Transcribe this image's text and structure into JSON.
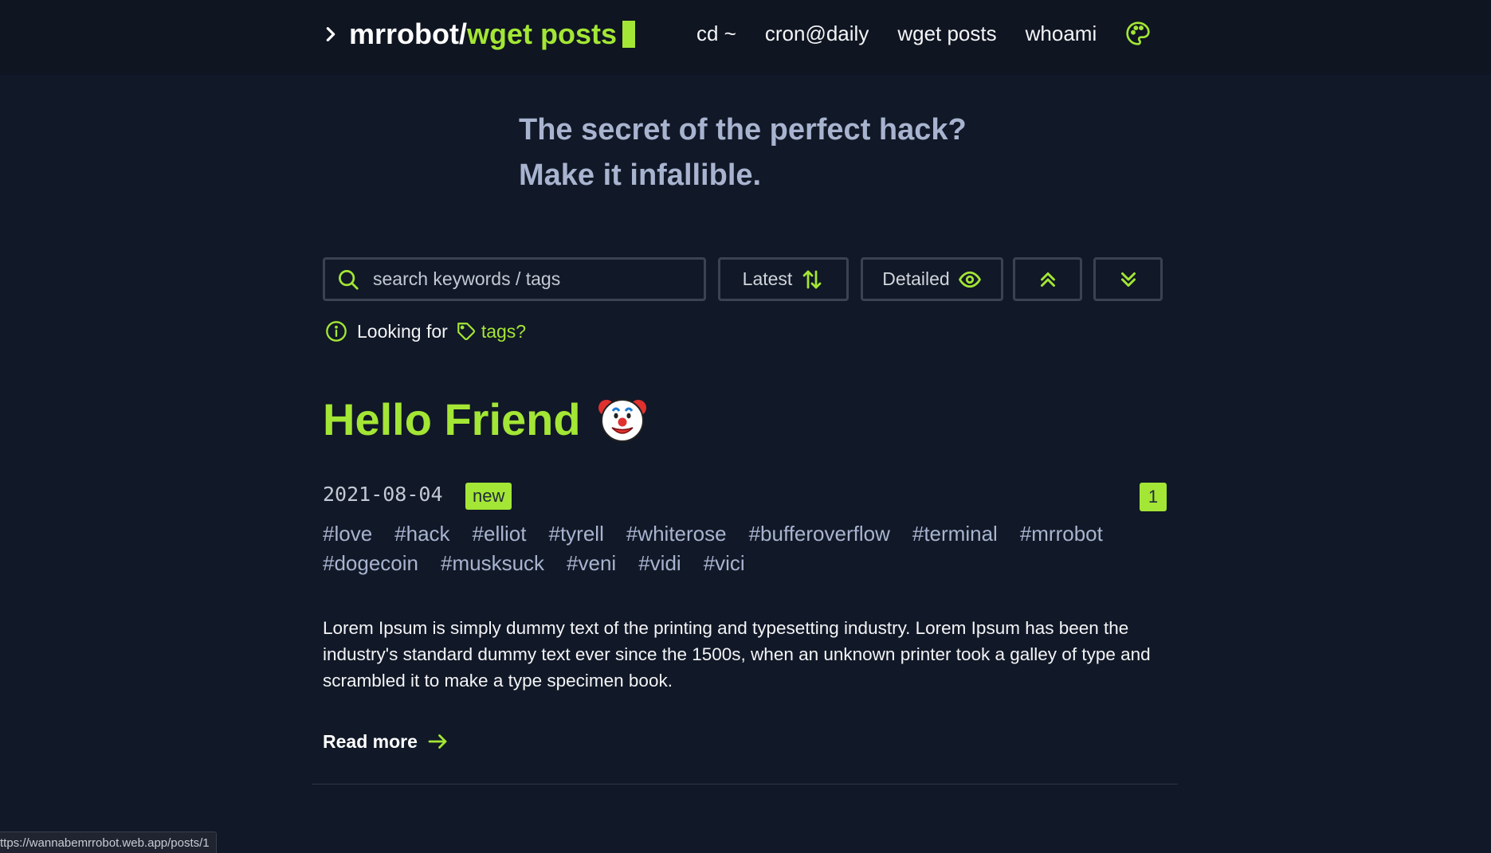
{
  "brand": {
    "prompt_icon": "chevron-right-icon",
    "user": "mrrobot/",
    "path": "wget posts"
  },
  "nav": {
    "items": [
      {
        "label": "cd ~"
      },
      {
        "label": "cron@daily"
      },
      {
        "label": "wget posts"
      },
      {
        "label": "whoami"
      }
    ],
    "theme_icon": "palette-icon"
  },
  "hero": {
    "line1": "The secret of the perfect hack?",
    "line2": "Make it infallible."
  },
  "toolbar": {
    "search_placeholder": "search keywords / tags",
    "sort_label": "Latest",
    "view_label": "Detailed",
    "accent": "#a3e635"
  },
  "hint": {
    "text": "Looking for",
    "link": "tags?"
  },
  "post": {
    "title": "Hello Friend",
    "emoji_icon": "clown-face-icon",
    "date": "2021-08-04",
    "badge": "new",
    "count": "1",
    "tags": [
      "#love",
      "#hack",
      "#elliot",
      "#tyrell",
      "#whiterose",
      "#bufferoverflow",
      "#terminal",
      "#mrrobot",
      "#dogecoin",
      "#musksuck",
      "#veni",
      "#vidi",
      "#vici"
    ],
    "excerpt": "Lorem Ipsum is simply dummy text of the printing and typesetting industry. Lorem Ipsum has been the industry's standard dummy text ever since the 1500s, when an unknown printer took a galley of type and scrambled it to make a type specimen book.",
    "read_more": "Read more"
  },
  "status": {
    "url": "ttps://wannabemrrobot.web.app/posts/1"
  }
}
